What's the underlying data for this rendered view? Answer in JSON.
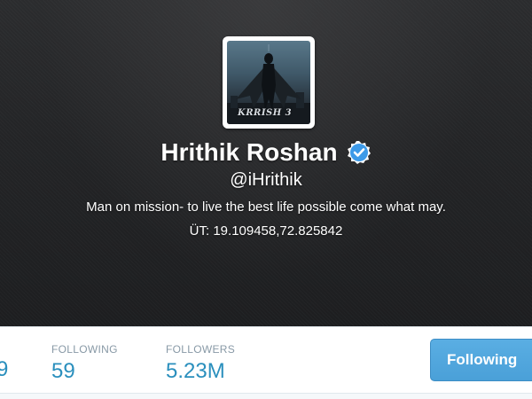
{
  "profile": {
    "name": "Hrithik Roshan",
    "handle": "@iHrithik",
    "bio": "Man on mission- to live the best life possible come what may.",
    "location": "ÜT: 19.109458,72.825842",
    "avatar_logo_text": "KRRISH 3",
    "verified_icon": "verified-badge-icon"
  },
  "stats": {
    "partial_value": "9",
    "following_label": "FOLLOWING",
    "following_value": "59",
    "followers_label": "FOLLOWERS",
    "followers_value": "5.23M"
  },
  "actions": {
    "follow_button_label": "Following"
  },
  "colors": {
    "header_bg": "#232426",
    "stat_value": "#2a8fbd",
    "stat_label": "#8899a6",
    "button_bg": "#55a9e0",
    "verified": "#1da1f2"
  }
}
